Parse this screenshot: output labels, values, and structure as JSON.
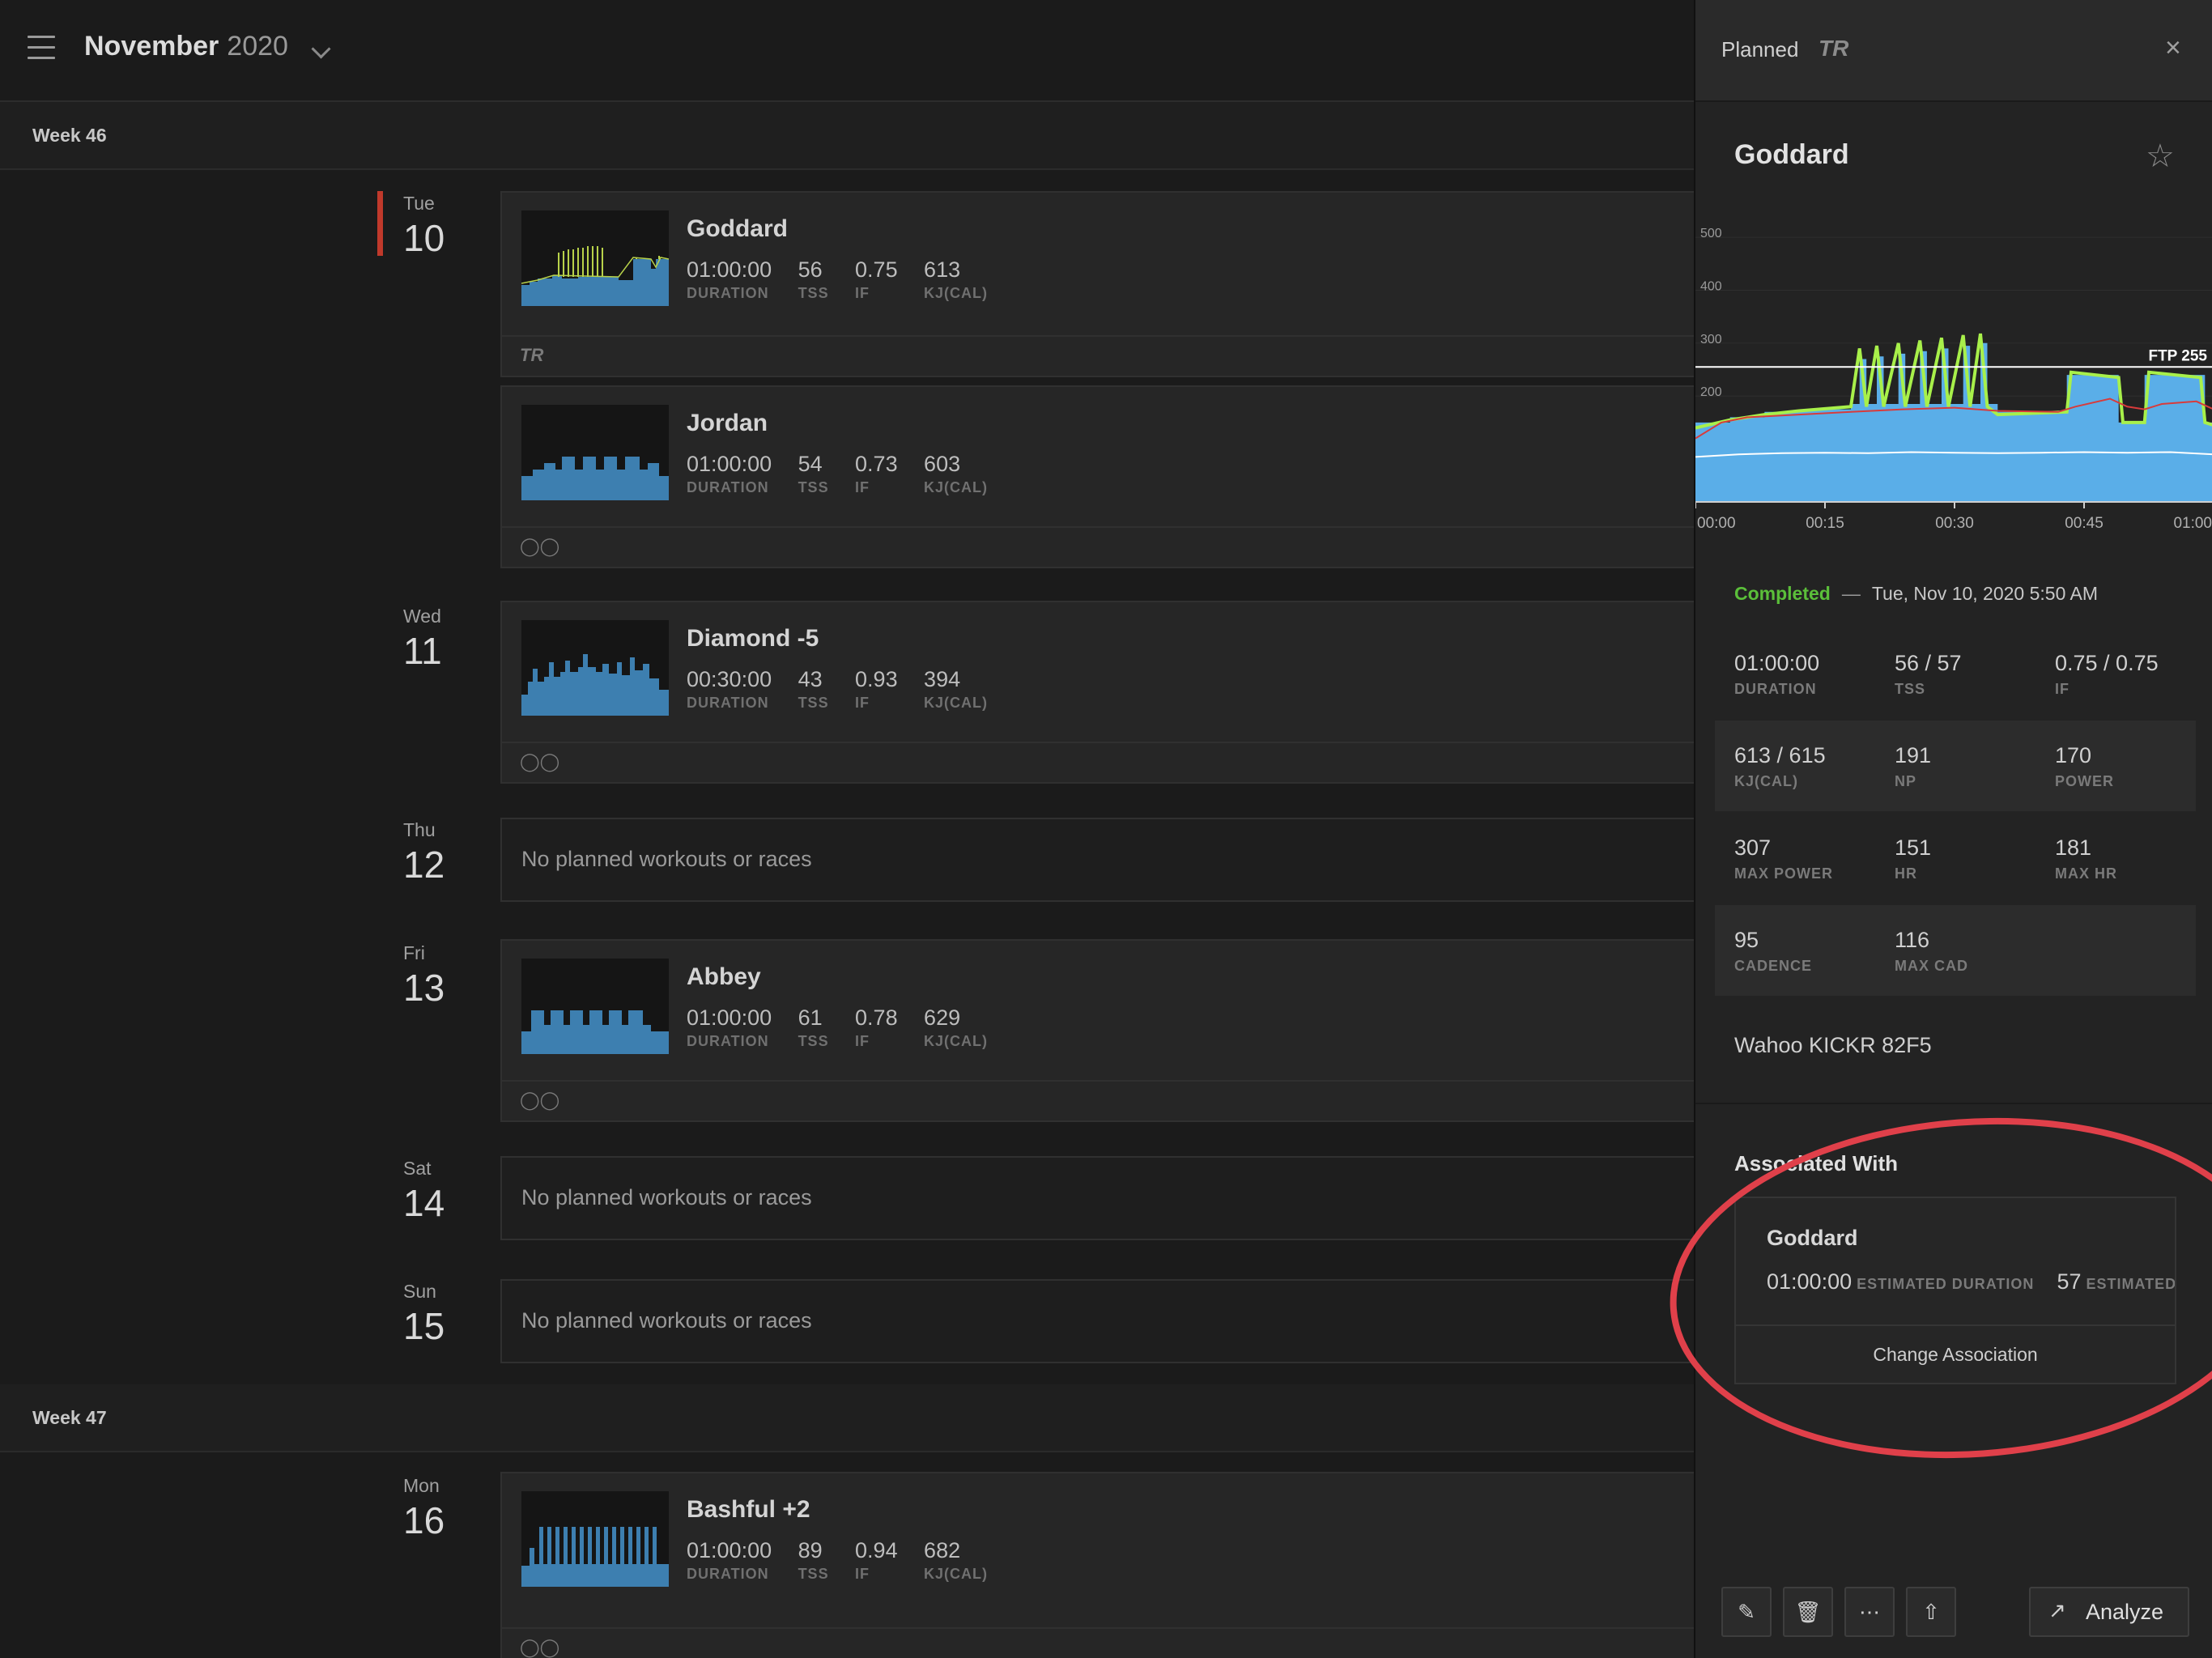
{
  "header": {
    "month": "November",
    "year": "2020"
  },
  "weeks": [
    {
      "label": "Week 46"
    },
    {
      "label": "Week 47"
    }
  ],
  "days": [
    {
      "dow": "Tue",
      "num": "10"
    },
    {
      "dow": "Wed",
      "num": "11"
    },
    {
      "dow": "Thu",
      "num": "12"
    },
    {
      "dow": "Fri",
      "num": "13"
    },
    {
      "dow": "Sat",
      "num": "14"
    },
    {
      "dow": "Sun",
      "num": "15"
    },
    {
      "dow": "Mon",
      "num": "16"
    }
  ],
  "metric_labels": {
    "duration": "DURATION",
    "tss": "TSS",
    "if": "IF",
    "kj": "KJ(CAL)"
  },
  "empty_text": "No planned workouts or races",
  "workouts": [
    {
      "name": "Goddard",
      "duration": "01:00:00",
      "tss": "56",
      "if": "0.75",
      "kj": "613",
      "footer_icon": "tr-logo-icon",
      "footer_text": "TR"
    },
    {
      "name": "Jordan",
      "duration": "01:00:00",
      "tss": "54",
      "if": "0.73",
      "kj": "603",
      "footer_icon": "bike-icon"
    },
    {
      "name": "Diamond -5",
      "duration": "00:30:00",
      "tss": "43",
      "if": "0.93",
      "kj": "394",
      "footer_icon": "bike-icon"
    },
    {
      "name": "Abbey",
      "duration": "01:00:00",
      "tss": "61",
      "if": "0.78",
      "kj": "629",
      "footer_icon": "bike-icon"
    },
    {
      "name": "Bashful +2",
      "duration": "01:00:00",
      "tss": "89",
      "if": "0.94",
      "kj": "682",
      "footer_icon": "bike-icon"
    }
  ],
  "panel": {
    "header_title": "Planned",
    "header_logo": "TR",
    "workout_title": "Goddard",
    "status": "Completed",
    "date": "Tue, Nov 10, 2020 5:50 AM",
    "stats": [
      [
        {
          "v": "01:00:00",
          "l": "DURATION"
        },
        {
          "v": "56 / 57",
          "l": "TSS"
        },
        {
          "v": "0.75 / 0.75",
          "l": "IF"
        }
      ],
      [
        {
          "v": "613 / 615",
          "l": "KJ(CAL)"
        },
        {
          "v": "191",
          "l": "NP"
        },
        {
          "v": "170",
          "l": "POWER"
        }
      ],
      [
        {
          "v": "307",
          "l": "MAX POWER"
        },
        {
          "v": "151",
          "l": "HR"
        },
        {
          "v": "181",
          "l": "MAX HR"
        }
      ],
      [
        {
          "v": "95",
          "l": "CADENCE"
        },
        {
          "v": "116",
          "l": "MAX CAD"
        }
      ]
    ],
    "device": "Wahoo KICKR 82F5",
    "assoc_title": "Associated With",
    "assoc_name": "Goddard",
    "assoc_duration": "01:00:00",
    "assoc_duration_label": "ESTIMATED DURATION",
    "assoc_tss": "57",
    "assoc_tss_label": "ESTIMATED TSS",
    "assoc_button": "Change Association",
    "analyze_label": "Analyze"
  },
  "chart_data": {
    "type": "area",
    "title": "",
    "xlabel": "",
    "ylabel": "",
    "x_ticks": [
      "00:00",
      "00:15",
      "00:30",
      "00:45",
      "01:00"
    ],
    "y_ticks": [
      "500",
      "400",
      "300",
      "200"
    ],
    "ylim": [
      0,
      520
    ],
    "ftp_label": "FTP 255",
    "ftp": 255,
    "colors": {
      "target_area": "#5aaee8",
      "power": "#a8f04a",
      "heart_rate": "#d83b3b",
      "cadence": "#ffffff"
    },
    "series": [
      {
        "name": "target",
        "points": [
          [
            0,
            150
          ],
          [
            4,
            150
          ],
          [
            4,
            160
          ],
          [
            8,
            160
          ],
          [
            8,
            170
          ],
          [
            12,
            170
          ],
          [
            12,
            175
          ],
          [
            18,
            175
          ],
          [
            18,
            185
          ],
          [
            19,
            185
          ],
          [
            19,
            270
          ],
          [
            19.8,
            270
          ],
          [
            19.8,
            185
          ],
          [
            21,
            185
          ],
          [
            21,
            275
          ],
          [
            21.8,
            275
          ],
          [
            21.8,
            185
          ],
          [
            23.5,
            185
          ],
          [
            23.5,
            280
          ],
          [
            24.3,
            280
          ],
          [
            24.3,
            185
          ],
          [
            26,
            185
          ],
          [
            26,
            285
          ],
          [
            26.8,
            285
          ],
          [
            26.8,
            185
          ],
          [
            28.5,
            185
          ],
          [
            28.5,
            290
          ],
          [
            29.3,
            290
          ],
          [
            29.3,
            185
          ],
          [
            31,
            185
          ],
          [
            31,
            295
          ],
          [
            31.8,
            295
          ],
          [
            31.8,
            185
          ],
          [
            33,
            185
          ],
          [
            33,
            300
          ],
          [
            33.8,
            300
          ],
          [
            33.8,
            185
          ],
          [
            35,
            185
          ],
          [
            35,
            170
          ],
          [
            43,
            170
          ],
          [
            43,
            240
          ],
          [
            49,
            240
          ],
          [
            49,
            150
          ],
          [
            52,
            150
          ],
          [
            52,
            240
          ],
          [
            59,
            240
          ],
          [
            59,
            150
          ],
          [
            60,
            150
          ]
        ]
      },
      {
        "name": "power",
        "points": [
          [
            0,
            140
          ],
          [
            4,
            155
          ],
          [
            8,
            165
          ],
          [
            12,
            172
          ],
          [
            18,
            180
          ],
          [
            19,
            290
          ],
          [
            19.8,
            180
          ],
          [
            21,
            295
          ],
          [
            21.8,
            180
          ],
          [
            23.5,
            300
          ],
          [
            24.3,
            180
          ],
          [
            26,
            305
          ],
          [
            26.8,
            180
          ],
          [
            28.5,
            310
          ],
          [
            29.3,
            180
          ],
          [
            31,
            315
          ],
          [
            31.8,
            180
          ],
          [
            33,
            318
          ],
          [
            33.8,
            180
          ],
          [
            35,
            165
          ],
          [
            43,
            170
          ],
          [
            43.5,
            245
          ],
          [
            49,
            235
          ],
          [
            49.5,
            150
          ],
          [
            52,
            150
          ],
          [
            52.5,
            245
          ],
          [
            58.5,
            235
          ],
          [
            59,
            150
          ],
          [
            60,
            145
          ]
        ]
      },
      {
        "name": "hr",
        "points": [
          [
            0,
            120
          ],
          [
            3,
            150
          ],
          [
            6,
            160
          ],
          [
            12,
            165
          ],
          [
            18,
            170
          ],
          [
            24,
            175
          ],
          [
            30,
            178
          ],
          [
            35,
            172
          ],
          [
            42,
            170
          ],
          [
            44,
            180
          ],
          [
            48,
            195
          ],
          [
            50,
            180
          ],
          [
            52,
            175
          ],
          [
            54,
            185
          ],
          [
            58,
            190
          ],
          [
            60,
            175
          ]
        ]
      },
      {
        "name": "cadence",
        "points": [
          [
            0,
            85
          ],
          [
            5,
            90
          ],
          [
            10,
            92
          ],
          [
            15,
            93
          ],
          [
            20,
            92
          ],
          [
            25,
            94
          ],
          [
            30,
            93
          ],
          [
            35,
            92
          ],
          [
            40,
            93
          ],
          [
            45,
            94
          ],
          [
            50,
            93
          ],
          [
            55,
            94
          ],
          [
            60,
            90
          ]
        ]
      }
    ]
  }
}
